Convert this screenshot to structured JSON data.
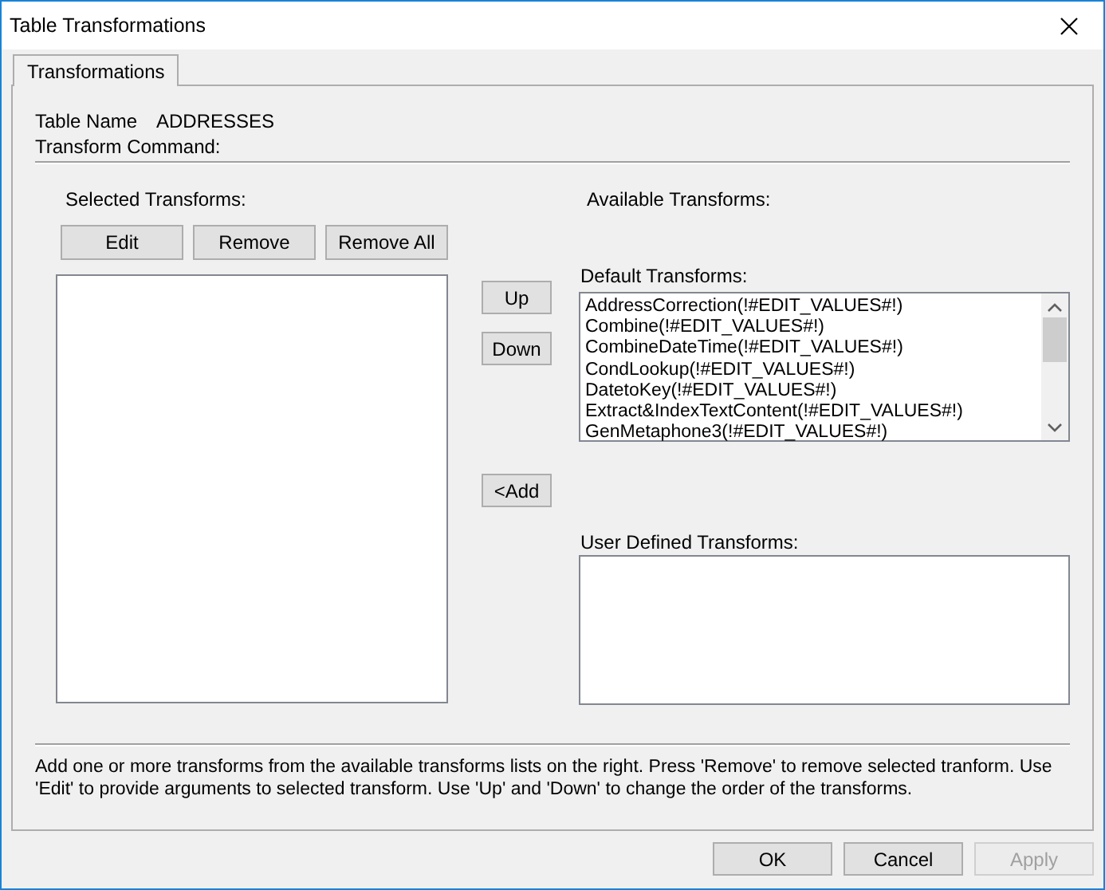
{
  "window": {
    "title": "Table Transformations"
  },
  "tabs": [
    {
      "label": "Transformations",
      "selected": true
    }
  ],
  "table_name": {
    "label": "Table Name",
    "value": "ADDRESSES"
  },
  "transform_command": {
    "label": "Transform Command:"
  },
  "selected_transforms": {
    "label": "Selected Transforms:",
    "buttons": [
      {
        "label": "Edit",
        "disabled": false
      },
      {
        "label": "Remove",
        "disabled": false
      },
      {
        "label": "Remove All",
        "disabled": false
      }
    ]
  },
  "order_buttons": [
    {
      "kind": "up",
      "label": "Up",
      "disabled": false
    },
    {
      "kind": "down",
      "label": "Down",
      "disabled": false
    },
    {
      "kind": "add",
      "label": "<Add",
      "disabled": false
    }
  ],
  "available_transforms": {
    "label": "Available Transforms:"
  },
  "default_transforms": {
    "label": "Default Transforms:",
    "items": [
      {
        "text": "AddressCorrection(!#EDIT_VALUES#!)",
        "selected": false
      },
      {
        "text": "Combine(!#EDIT_VALUES#!)",
        "selected": false
      },
      {
        "text": "CombineDateTime(!#EDIT_VALUES#!)",
        "selected": false
      },
      {
        "text": "CondLookup(!#EDIT_VALUES#!)",
        "selected": false
      },
      {
        "text": "DatetoKey(!#EDIT_VALUES#!)",
        "selected": false
      },
      {
        "text": "Extract&IndexTextContent(!#EDIT_VALUES#!)",
        "selected": false
      },
      {
        "text": "GenMetaphone3(!#EDIT_VALUES#!)",
        "selected": false
      }
    ]
  },
  "user_defined_transforms": {
    "label": "User Defined Transforms:"
  },
  "help_text": "Add one or more transforms from the available transforms lists on the right. Press 'Remove' to remove selected tranform. Use 'Edit' to provide arguments to selected transform. Use 'Up' and 'Down' to change the order of the transforms.",
  "dialog_buttons": [
    {
      "label": "OK",
      "disabled": false
    },
    {
      "label": "Cancel",
      "disabled": false
    },
    {
      "label": "Apply",
      "disabled": true
    }
  ]
}
